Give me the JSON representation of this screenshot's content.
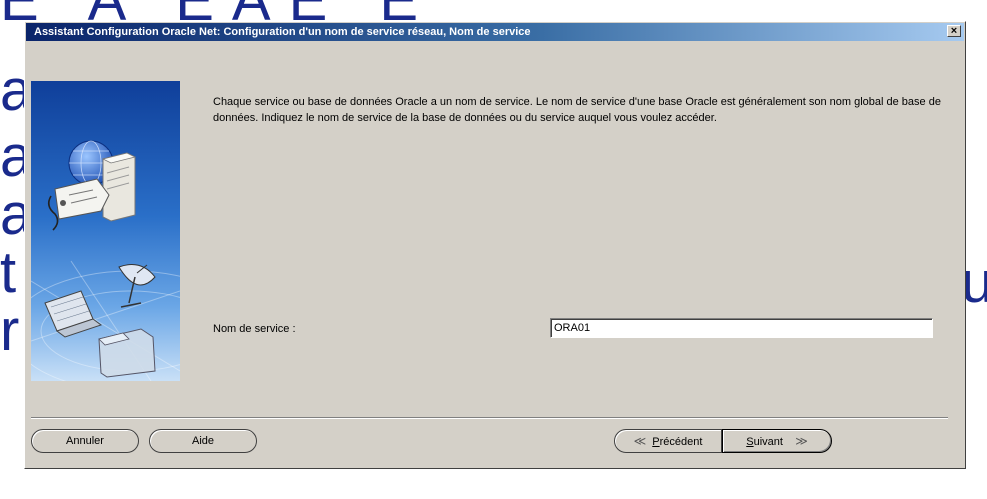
{
  "background": {
    "fragments": {
      "top": "E A EAE E",
      "a1": "a",
      "a2": "a",
      "a3": "a",
      "t": "t",
      "r": "r",
      "u": "u"
    }
  },
  "dialog": {
    "title": "Assistant Configuration Oracle Net: Configuration d'un nom de service réseau, Nom de service",
    "close_label": "×",
    "description": "Chaque service ou base de données Oracle a un nom de service. Le nom de service d'une base Oracle est généralement son nom global de base de données. Indiquez le nom de service de la base de données ou du service auquel vous voulez accéder.",
    "service_label": "Nom de service :",
    "service_value": "ORA01",
    "buttons": {
      "cancel": "Annuler",
      "help": "Aide",
      "prev_accel": "P",
      "prev_rest": "récédent",
      "next_accel": "S",
      "next_rest": "uivant",
      "prev_arrow": "≪",
      "next_arrow": "≫"
    }
  },
  "colors": {
    "dialog_bg": "#d4d0c8",
    "title_start": "#0a246a",
    "title_end": "#a6caf0",
    "background_text": "#1a2a8c"
  },
  "icons": [
    "globe-icon",
    "server-icon",
    "network-tag-icon",
    "satellite-dish-icon",
    "laptop-icon",
    "folder-icon",
    "close-icon"
  ]
}
